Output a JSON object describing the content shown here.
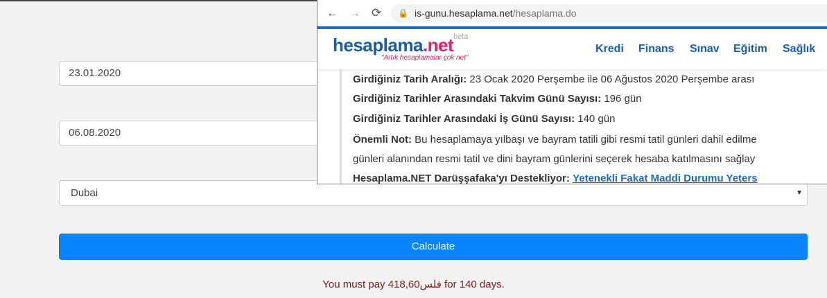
{
  "form": {
    "start_date": "23.01.2020",
    "end_date": "06.08.2020",
    "city": "Dubai",
    "calculate_label": "Calculate",
    "result": "You must pay 418,60فلس for 140 days."
  },
  "overlay": {
    "url_host": "is-gunu.hesaplama.net",
    "url_path": "/hesaplama.do",
    "logo_main": "hesaplama",
    "logo_net": ".net",
    "logo_beta": "beta",
    "logo_slogan": "\"Artık hesaplamalar çok net\"",
    "menu": [
      "Kredi",
      "Finans",
      "Sınav",
      "Eğitim",
      "Sağlık"
    ],
    "lines": [
      {
        "label": "Girdiğiniz Tarih Aralığı:",
        "value": " 23 Ocak 2020 Perşembe ile 06 Ağustos 2020 Perşembe arası"
      },
      {
        "label": "Girdiğiniz Tarihler Arasındaki Takvim Günü Sayısı:",
        "value": " 196 gün"
      },
      {
        "label": "Girdiğiniz Tarihler Arasındaki İş Günü Sayısı:",
        "value": " 140 gün"
      },
      {
        "label": "Önemli Not:",
        "value": " Bu hesaplamaya yılbaşı ve bayram tatili gibi resmi tatil günleri dahil edilme"
      },
      {
        "label": "",
        "value": "günleri alanından resmi tatil ve dini bayram günlerini seçerek hesaba katılmasını sağlay"
      },
      {
        "label": "Hesaplama.NET Darüşşafaka'yı Destekliyor:",
        "link": "Yetenekli Fakat Maddi Durumu Yeters"
      }
    ]
  }
}
